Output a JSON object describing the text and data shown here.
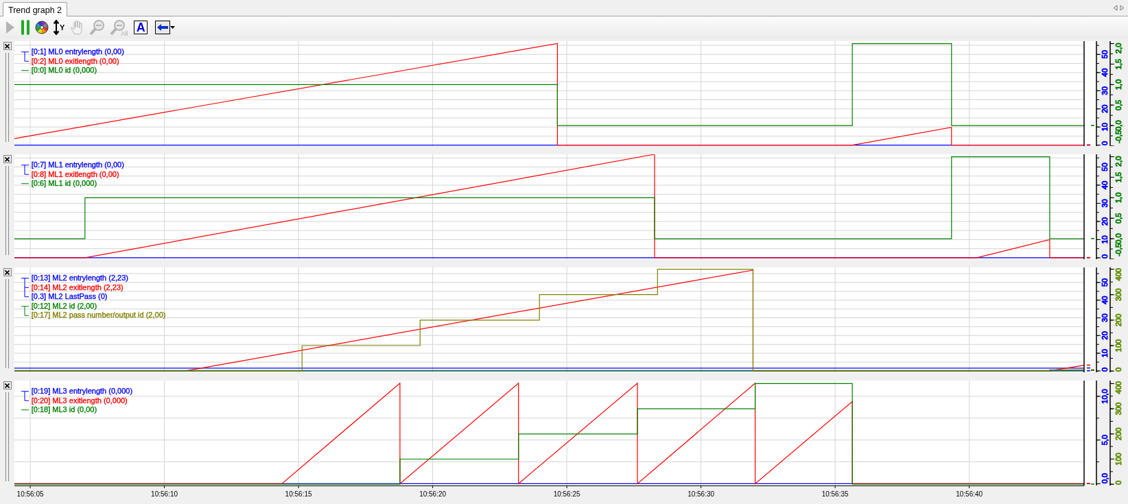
{
  "tab": {
    "label": "Trend graph 2",
    "selected": true
  },
  "toolbar": [
    {
      "kind": "play",
      "disabled": true
    },
    {
      "kind": "pause",
      "disabled": false
    },
    {
      "kind": "colors",
      "disabled": false
    },
    {
      "kind": "axis",
      "label": "Y",
      "disabled": false
    },
    {
      "kind": "pan",
      "disabled": true
    },
    {
      "kind": "zoom_out",
      "disabled": true
    },
    {
      "kind": "zoom_all",
      "label": "All",
      "disabled": true
    },
    {
      "kind": "font",
      "label": "A",
      "disabled": false
    },
    {
      "kind": "arrow",
      "disabled": false,
      "dropdown": true
    }
  ],
  "panels": [
    {
      "legend_groups": [
        {
          "entries": [
            {
              "text": "[0:1] ML0 entrylength (0,00)",
              "color": "#0000ff"
            },
            {
              "text": "[0:2] ML0 exitlength (0,00)",
              "color": "#ff0000"
            }
          ]
        },
        {
          "entries": [
            {
              "text": "[0:0] ML0 id (0,000)",
              "color": "#008000"
            }
          ]
        }
      ],
      "left_axis": {
        "color": "#0000ff",
        "labels": [
          "0",
          "10",
          "20",
          "30",
          "40",
          "50"
        ]
      },
      "right_axis": {
        "color": "#008000",
        "labels": [
          "-0,5",
          "0,0",
          "0,5",
          "1,0",
          "1,5",
          "2,0"
        ]
      }
    },
    {
      "legend_groups": [
        {
          "entries": [
            {
              "text": "[0:7] ML1 entrylength (0,00)",
              "color": "#0000ff"
            },
            {
              "text": "[0:8] ML1 exitlength (0,00)",
              "color": "#ff0000"
            }
          ]
        },
        {
          "entries": [
            {
              "text": "[0:6] ML1 id (0,000)",
              "color": "#008000"
            }
          ]
        }
      ],
      "left_axis": {
        "color": "#0000ff",
        "labels": [
          "0",
          "10",
          "20",
          "30",
          "40",
          "50"
        ]
      },
      "right_axis": {
        "color": "#008000",
        "labels": [
          "-0,5",
          "0,0",
          "0,5",
          "1,0",
          "1,5",
          "2,0"
        ]
      }
    },
    {
      "legend_groups": [
        {
          "entries": [
            {
              "text": "[0:13] ML2 entrylength (2,23)",
              "color": "#0000ff"
            },
            {
              "text": "[0:14] ML2 exitlength (2,23)",
              "color": "#ff0000"
            },
            {
              "text": "[0.3] ML2 LastPass (0)",
              "color": "#0000ff"
            }
          ]
        },
        {
          "entries": [
            {
              "text": "[0:12] ML2 id (2,00)",
              "color": "#008000"
            },
            {
              "text": "[0:17] ML2 pass number/output id (2,00)",
              "color": "#808000"
            }
          ]
        }
      ],
      "left_axis": {
        "color": "#0000ff",
        "labels": [
          "0",
          "10",
          "20",
          "30",
          "40",
          "50"
        ]
      },
      "right_axis": {
        "color": "#5f8f00",
        "labels": [
          "0",
          "100",
          "200",
          "300",
          "400"
        ]
      }
    },
    {
      "legend_groups": [
        {
          "entries": [
            {
              "text": "[0:19] ML3 entrylength (0,000)",
              "color": "#0000ff"
            },
            {
              "text": "[0:20] ML3 exitlength (0,000)",
              "color": "#ff0000"
            }
          ]
        },
        {
          "entries": [
            {
              "text": "[0:18] ML3 id (0,00)",
              "color": "#008000"
            }
          ]
        }
      ],
      "left_axis": {
        "color": "#0000ff",
        "labels": [
          "0,0",
          "5,0",
          "10,0"
        ]
      },
      "right_axis": {
        "color": "#5f8f00",
        "labels": [
          "0",
          "100",
          "200",
          "300",
          "400"
        ]
      }
    }
  ],
  "x_axis": {
    "labels": [
      "10:56:05",
      "10:56:10",
      "10:56:15",
      "10:56:20",
      "10:56:25",
      "10:56:30",
      "10:56:35",
      "10:56:40"
    ]
  }
}
